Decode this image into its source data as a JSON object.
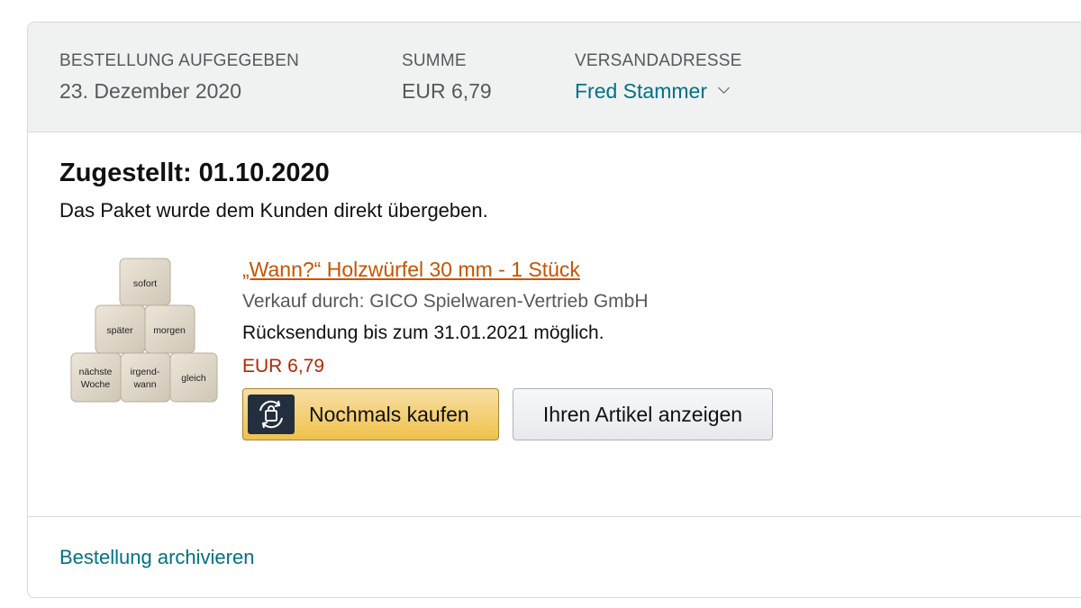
{
  "order_header": {
    "placed_label": "BESTELLUNG AUFGEGEBEN",
    "placed_date": "23. Dezember 2020",
    "total_label": "SUMME",
    "total_value": "EUR 6,79",
    "shipping_label": "VERSANDADRESSE",
    "shipping_name": "Fred Stammer"
  },
  "delivery": {
    "title": "Zugestellt: 01.10.2020",
    "subtitle": "Das Paket wurde dem Kunden direkt übergeben."
  },
  "product": {
    "title": "„Wann?“ Holzwürfel 30 mm - 1 Stück",
    "seller": "Verkauf durch: GICO Spielwaren-Vertrieb GmbH",
    "return_info": "Rücksendung bis zum 31.01.2021 möglich.",
    "price": "EUR 6,79",
    "image_dice_words": {
      "top": "sofort",
      "mid_left": "später",
      "mid_right": "morgen",
      "bottom_left_1": "nächste",
      "bottom_left_2": "Woche",
      "bottom_mid_1": "irgend-",
      "bottom_mid_2": "wann",
      "bottom_right": "gleich"
    }
  },
  "actions": {
    "buy_again_label": "Nochmals kaufen",
    "view_item_label": "Ihren Artikel anzeigen",
    "archive_label": "Bestellung archivieren"
  },
  "colors": {
    "link": "#007185",
    "product_link": "#c45500",
    "price": "#b12704",
    "buy_button": "#f0c14b",
    "header_bg": "#f0f2f2"
  },
  "icons": {
    "buy_again": "shopping-bag-refresh-icon",
    "dropdown": "chevron-down-icon"
  }
}
